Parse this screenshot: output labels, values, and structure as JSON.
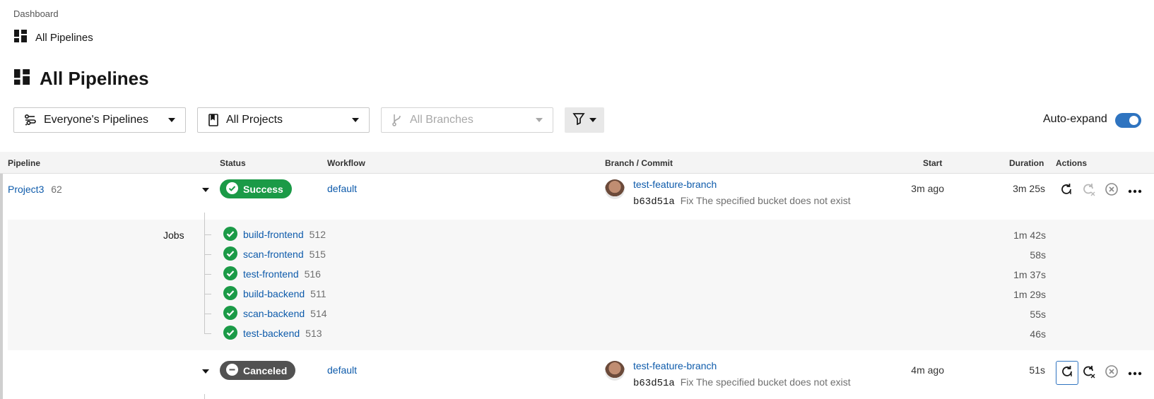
{
  "breadcrumb": {
    "root": "Dashboard",
    "current": "All Pipelines"
  },
  "page_title": "All Pipelines",
  "filters": {
    "pipelines_select": "Everyone's Pipelines",
    "projects_select": "All Projects",
    "branches_select": "All Branches",
    "auto_expand_label": "Auto-expand",
    "auto_expand_on": true
  },
  "table": {
    "headers": {
      "pipeline": "Pipeline",
      "status": "Status",
      "workflow": "Workflow",
      "branch_commit": "Branch / Commit",
      "start": "Start",
      "duration": "Duration",
      "actions": "Actions"
    },
    "rows": [
      {
        "project": "Project3",
        "number": "62",
        "status": "Success",
        "workflow": "default",
        "branch": "test-feature-branch",
        "sha": "b63d51a",
        "message": "Fix The specified bucket does not exist",
        "start": "3m ago",
        "duration": "3m 25s",
        "jobs_label": "Jobs",
        "jobs": [
          {
            "name": "build-frontend",
            "num": "512",
            "duration": "1m 42s"
          },
          {
            "name": "scan-frontend",
            "num": "515",
            "duration": "58s"
          },
          {
            "name": "test-frontend",
            "num": "516",
            "duration": "1m 37s"
          },
          {
            "name": "build-backend",
            "num": "511",
            "duration": "1m 29s"
          },
          {
            "name": "scan-backend",
            "num": "514",
            "duration": "55s"
          },
          {
            "name": "test-backend",
            "num": "513",
            "duration": "46s"
          }
        ]
      },
      {
        "status": "Canceled",
        "workflow": "default",
        "branch": "test-feature-branch",
        "sha": "b63d51a",
        "message": "Fix The specified bucket does not exist",
        "start": "4m ago",
        "duration": "51s"
      }
    ]
  },
  "colors": {
    "success": "#1b9a47",
    "canceled": "#525252",
    "link": "#0e5bab",
    "toggle": "#2f74c0"
  }
}
